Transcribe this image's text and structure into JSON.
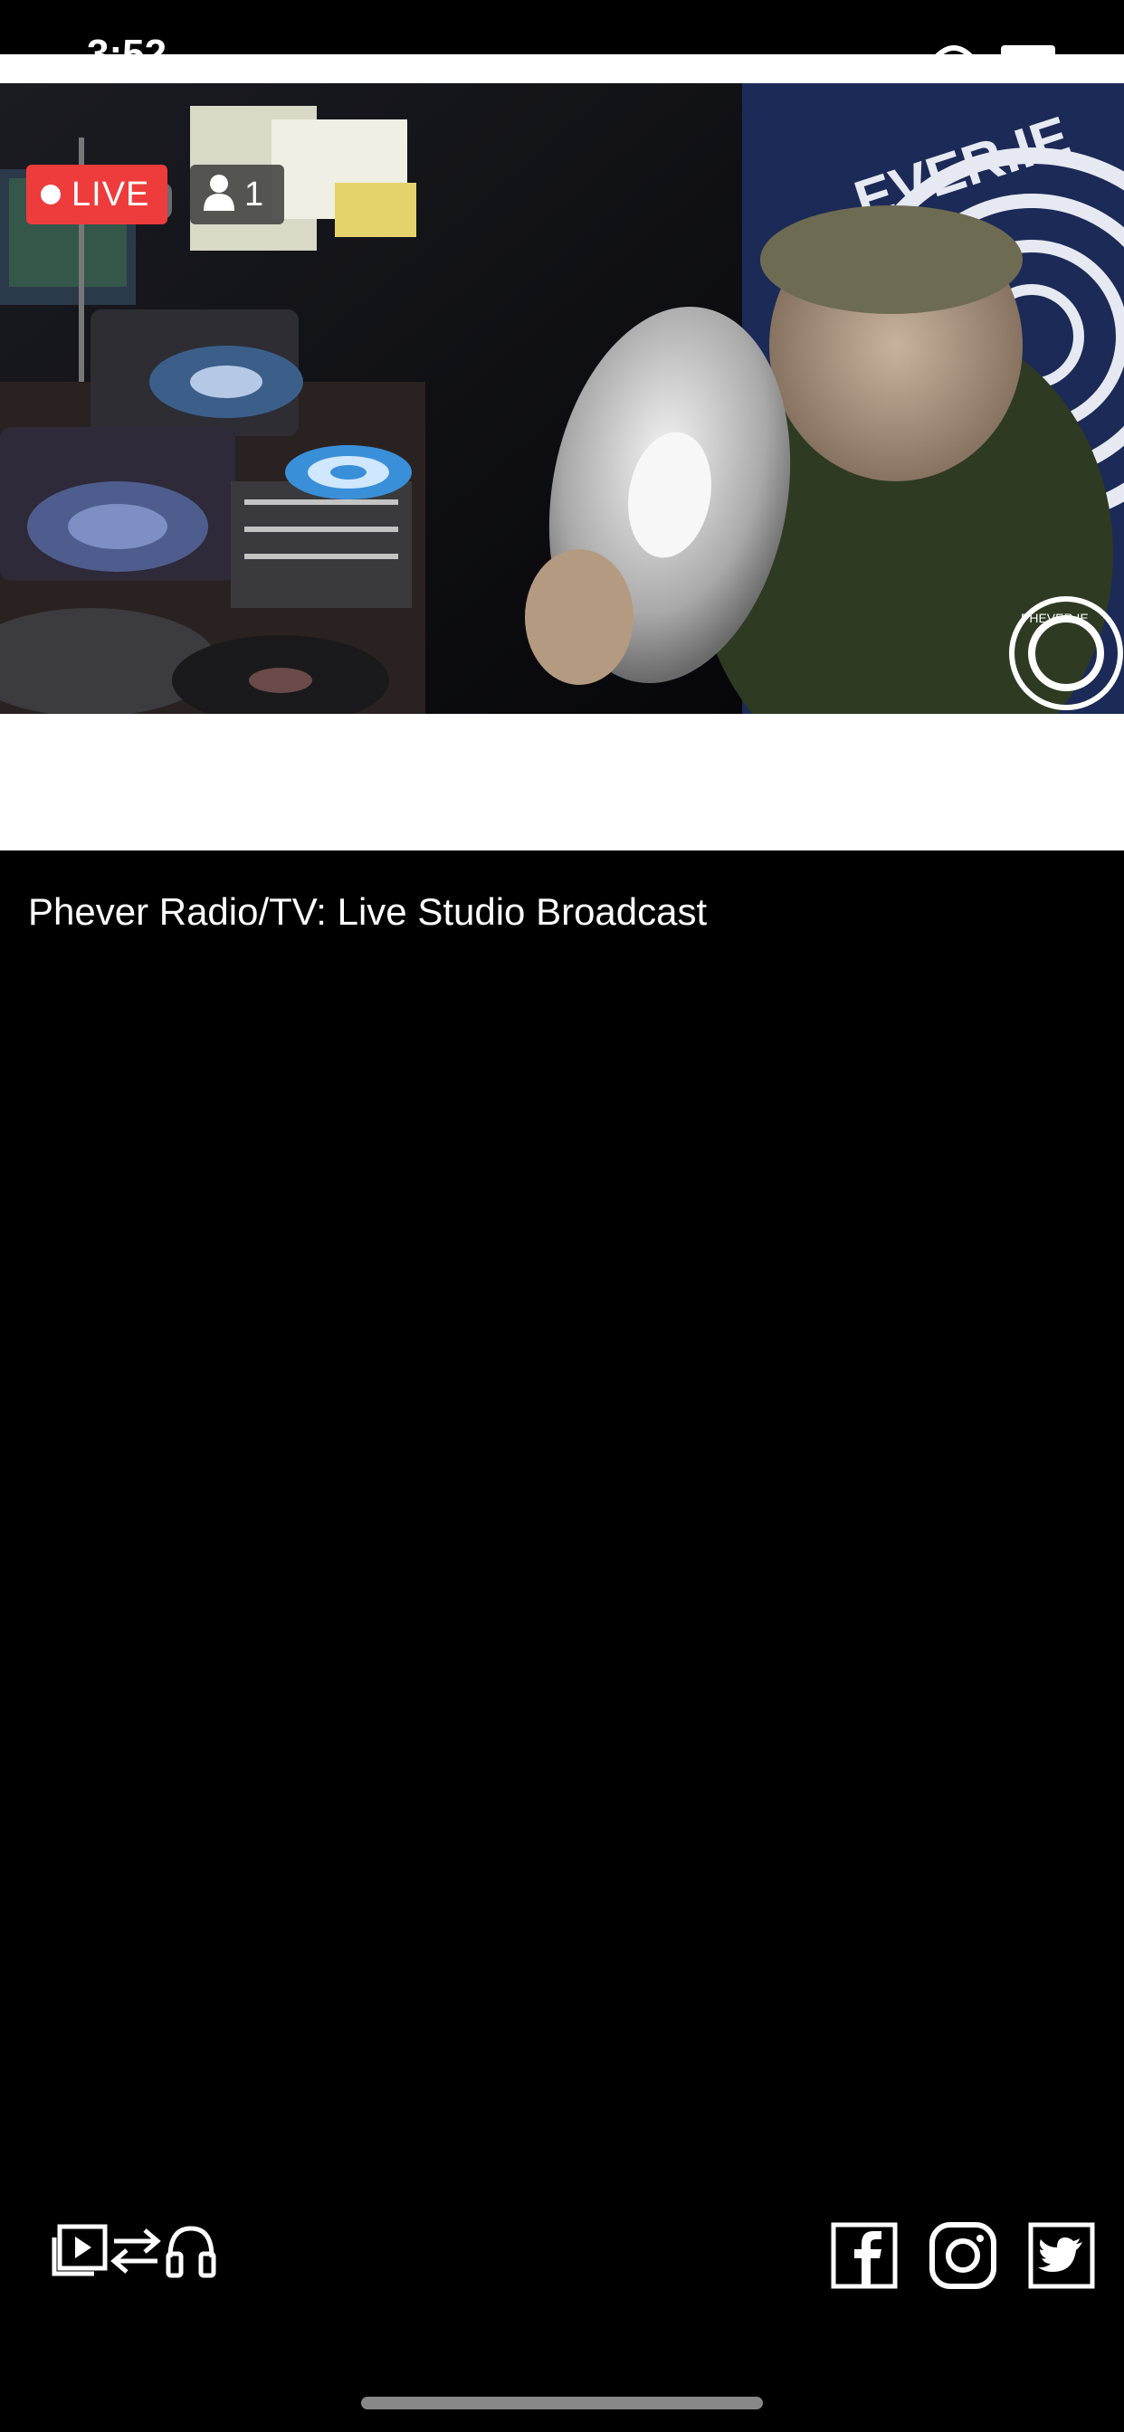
{
  "status_bar": {
    "time": "3:52"
  },
  "player": {
    "live_label": "LIVE",
    "viewer_count": "1",
    "watermark": "PHEVER.IE"
  },
  "video": {
    "title": "Phever Radio/TV: Live Studio Broadcast"
  },
  "toolbar": {
    "left_icons": [
      "video-playlist-icon",
      "swap-arrows-icon",
      "headphones-icon"
    ],
    "right_icons": [
      "facebook-icon",
      "instagram-icon",
      "twitter-icon"
    ]
  },
  "colors": {
    "live_red": "#ee3c3c",
    "background": "#000000"
  }
}
